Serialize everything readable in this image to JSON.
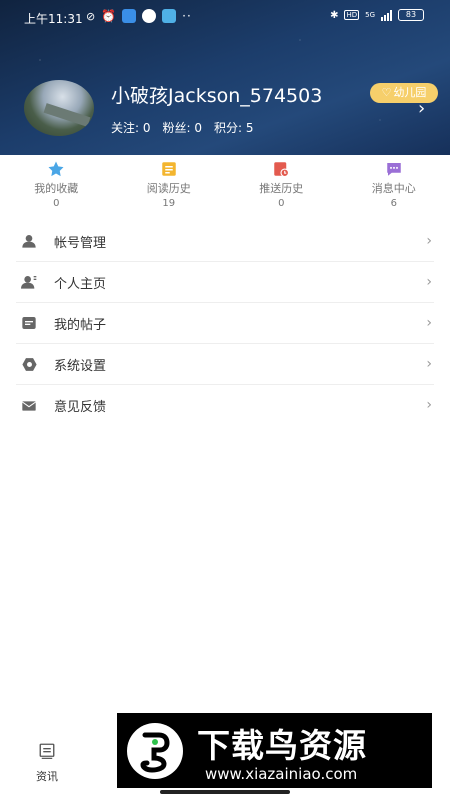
{
  "status_bar": {
    "time": "上午11:31",
    "battery": "83",
    "network": "5G"
  },
  "profile": {
    "username": "小破孩Jackson_574503",
    "badge": "幼儿园",
    "follow_label": "关注: 0",
    "fans_label": "粉丝: 0",
    "points_label": "积分: 5"
  },
  "quick_items": [
    {
      "label": "我的收藏",
      "count": "0",
      "icon": "star-icon",
      "color": "#4aa6e6"
    },
    {
      "label": "阅读历史",
      "count": "19",
      "icon": "history-icon",
      "color": "#f3b52f"
    },
    {
      "label": "推送历史",
      "count": "0",
      "icon": "push-history-icon",
      "color": "#e35a4e"
    },
    {
      "label": "消息中心",
      "count": "6",
      "icon": "message-icon",
      "color": "#9a6fd6"
    }
  ],
  "menu": [
    {
      "label": "帐号管理",
      "icon": "user-icon"
    },
    {
      "label": "个人主页",
      "icon": "profile-icon"
    },
    {
      "label": "我的帖子",
      "icon": "posts-icon"
    },
    {
      "label": "系统设置",
      "icon": "settings-icon"
    },
    {
      "label": "意见反馈",
      "icon": "mail-icon"
    }
  ],
  "bottom_nav": {
    "news_label": "资讯"
  },
  "watermark": {
    "title": "下载鸟资源",
    "url": "www.xiazainiao.com"
  },
  "colors": {
    "header_bg": "#1c3d6b",
    "badge": "#f6cf6b",
    "menu_icon": "#666666"
  }
}
